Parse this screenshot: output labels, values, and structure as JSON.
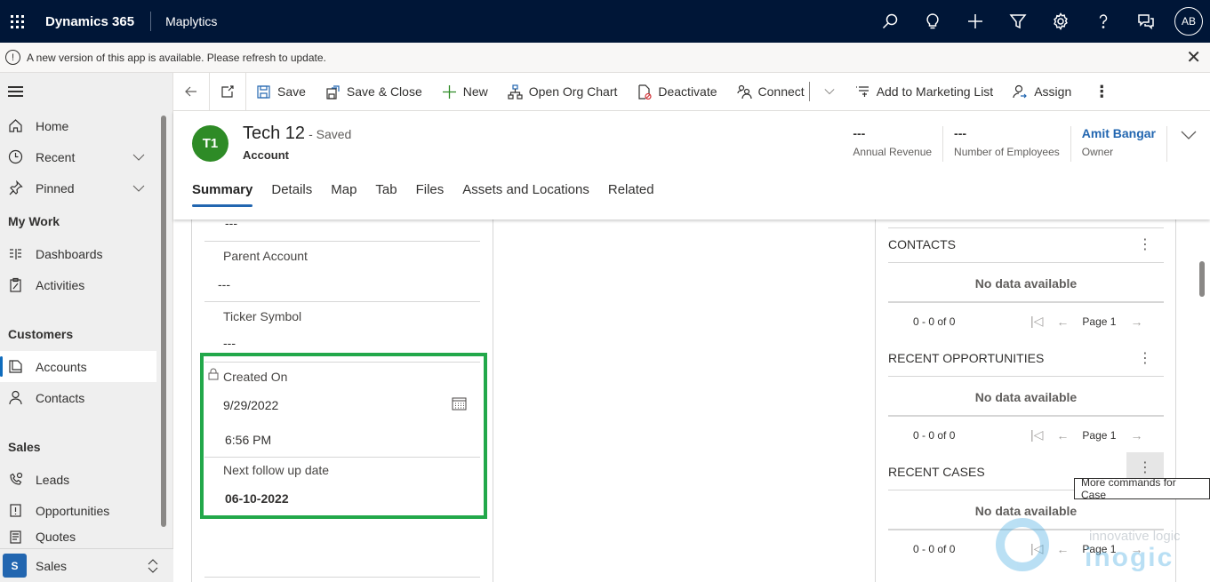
{
  "topbar": {
    "brand": "Dynamics 365",
    "app_name": "Maplytics",
    "icons": [
      "search-icon",
      "lightbulb-icon",
      "plus-icon",
      "filter-icon",
      "settings-icon",
      "help-icon",
      "chat-icon"
    ],
    "user_initials": "AB"
  },
  "notification": {
    "message": "A new version of this app is available. Please refresh to update."
  },
  "sidebar": {
    "items_top": [
      {
        "label": "Home",
        "icon": "home-icon"
      },
      {
        "label": "Recent",
        "icon": "clock-icon",
        "expandable": true
      },
      {
        "label": "Pinned",
        "icon": "pin-icon",
        "expandable": true
      }
    ],
    "sections": [
      {
        "title": "My Work",
        "items": [
          {
            "label": "Dashboards",
            "icon": "dashboard-icon"
          },
          {
            "label": "Activities",
            "icon": "clipboard-icon"
          }
        ]
      },
      {
        "title": "Customers",
        "items": [
          {
            "label": "Accounts",
            "icon": "accounts-icon",
            "active": true
          },
          {
            "label": "Contacts",
            "icon": "person-icon"
          }
        ]
      },
      {
        "title": "Sales",
        "items": [
          {
            "label": "Leads",
            "icon": "leads-icon"
          },
          {
            "label": "Opportunities",
            "icon": "opportunity-icon"
          },
          {
            "label": "Quotes",
            "icon": "quote-icon"
          }
        ]
      }
    ],
    "area": {
      "badge": "S",
      "label": "Sales"
    }
  },
  "commandbar": {
    "buttons": [
      {
        "label": "Save",
        "icon": "save-icon"
      },
      {
        "label": "Save & Close",
        "icon": "save-close-icon"
      },
      {
        "label": "New",
        "icon": "plus-icon"
      },
      {
        "label": "Open Org Chart",
        "icon": "org-chart-icon"
      },
      {
        "label": "Deactivate",
        "icon": "deactivate-icon"
      },
      {
        "label": "Connect",
        "icon": "connect-icon"
      },
      {
        "label": "Add to Marketing List",
        "icon": "marketing-list-icon"
      },
      {
        "label": "Assign",
        "icon": "assign-icon"
      }
    ]
  },
  "record": {
    "initials": "T1",
    "avatar_color": "#2e8b26",
    "title": "Tech 12",
    "save_status": "- Saved",
    "entity": "Account",
    "header_fields": [
      {
        "value": "---",
        "label": "Annual Revenue"
      },
      {
        "value": "---",
        "label": "Number of Employees"
      },
      {
        "value": "Amit Bangar",
        "label": "Owner",
        "link": true
      }
    ],
    "tabs": [
      "Summary",
      "Details",
      "Map",
      "Tab",
      "Files",
      "Assets and Locations",
      "Related"
    ],
    "active_tab": "Summary"
  },
  "form": {
    "top_value": "---",
    "fields": [
      {
        "label": "Parent Account",
        "value": "---"
      },
      {
        "label": "Ticker Symbol",
        "value": "---"
      }
    ],
    "created_on": {
      "label": "Created On",
      "date": "9/29/2022",
      "time": "6:56 PM",
      "locked": true
    },
    "next_follow_up": {
      "label": "Next follow up date",
      "value": "06-10-2022"
    },
    "highlight_color": "#22a84a"
  },
  "subgrids": [
    {
      "title": "CONTACTS",
      "empty": "No data available",
      "count": "0 - 0 of 0",
      "page": "Page 1"
    },
    {
      "title": "RECENT OPPORTUNITIES",
      "empty": "No data available",
      "count": "0 - 0 of 0",
      "page": "Page 1"
    },
    {
      "title": "RECENT CASES",
      "empty": "No data available",
      "count": "0 - 0 of 0",
      "page": "Page 1"
    }
  ],
  "tooltip": "More commands for Case",
  "watermark": {
    "line1": "innovative logic",
    "line2": "inogic"
  },
  "colors": {
    "topbar": "#001637",
    "accent": "#2266b0",
    "highlight": "#22a84a"
  }
}
